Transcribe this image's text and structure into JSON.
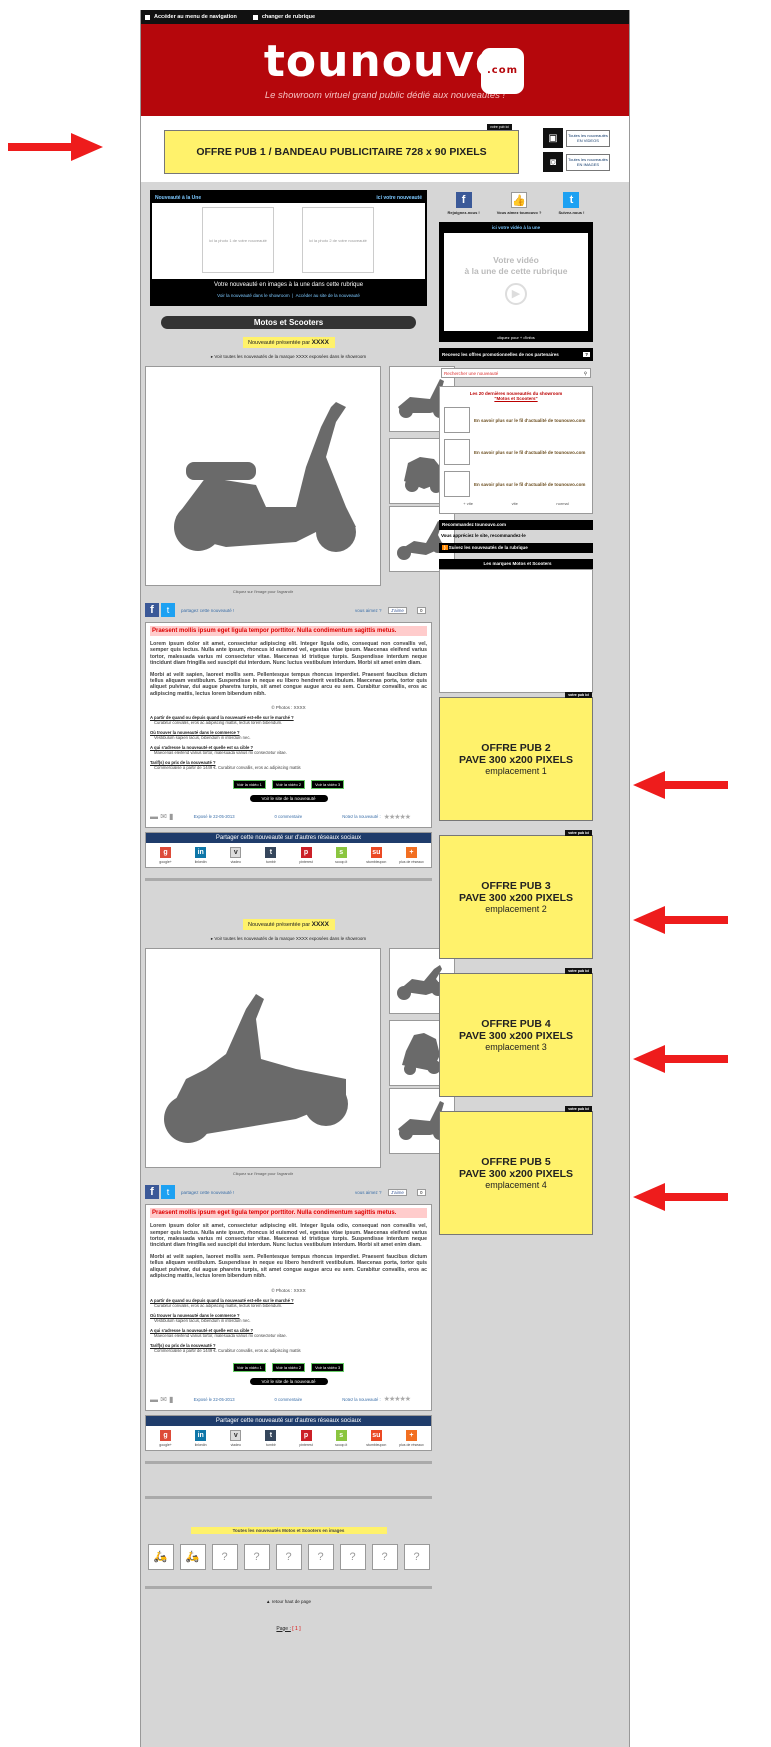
{
  "topbar": {
    "nav_link": "Accéder au menu de navigation",
    "change_link": "changer de rubrique"
  },
  "header": {
    "logo": "tounouvo",
    "logo_com": ".com",
    "tagline": "Le showroom virtuel grand public dédié aux nouveautés !"
  },
  "leaderboard": {
    "tag": "votre pub ici",
    "text": "OFFRE PUB 1 / BANDEAU PUBLICITAIRE 728 x 90 PIXELS",
    "videos_link": "Toutes les nouveautés EN VIDEOS",
    "images_link": "Toutes les nouveautés EN IMAGES"
  },
  "featured": {
    "title": "Nouveauté à la Une",
    "right_label": "ici votre nouveauté",
    "photo1": "ici la photo 1 de votre nouveauté",
    "photo2": "ici la photo 2 de votre nouveauté",
    "caption": "Votre nouveauté en images à la une dans cette rubrique",
    "link1": "Voir la nouveauté dans le showroom",
    "link2": "Accéder au site de la nouveauté"
  },
  "category_title": "Motos et Scooters",
  "products": [
    {
      "presented_by": "Nouveauté présentée par",
      "brand": "XXXX",
      "see_all": "Voir toutes les nouveautés de la marque XXXX exposées dans le showroom",
      "click_hint": "Cliquez sur l'image pour l'agrandir",
      "share_text": "partagez cette nouveauté !",
      "like_text": "vous aimez ?",
      "like_btn": "J'aime",
      "like_count": "0",
      "title": "Praesent mollis ipsum eget ligula tempor porttitor. Nulla condimentum sagittis metus.",
      "p1": "Lorem ipsum dolor sit amet, consectetur adipiscing elit. Integer ligula odio, consequat non convallis vel, semper quis lectus. Nulla ante ipsum, rhoncus id euismod vel, egestas vitae ipsum. Maecenas eleifend varius tortor, malesuada varius mi consectetur vitae. Maecenas id tristique turpis. Suspendisse interdum neque tincidunt diam fringilla sed suscipit dui interdum. Nunc luctus vestibulum interdum. Morbi sit amet enim diam.",
      "p2": "Morbi at velit sapien, laoreet mollis sem. Pellentesque tempus rhoncus imperdiet. Praesent faucibus dictum tellus aliquam vestibulum. Suspendisse in neque eu libero hendrerit vestibulum. Maecenas porta, tortor quis aliquet pulvinar, dui augue pharetra turpis, sit amet congue augue arcu eu sem. Curabitur convallis, eros ac adipiscing mattis, lectus lorem bibendum nibh.",
      "photo_credit": "© Photos : XXXX",
      "q1": "A partir de quand ou depuis quand la nouveauté est-elle sur le marché ?",
      "a1": "Curabitur convallis, eros ac adipiscing mattis, lectus lorem bibendum.",
      "q2": "Où trouver la nouveauté dans le commerce ?",
      "a2": "Vestibulum sapien lacus, bibendum in interdum nec.",
      "q3": "A qui s'adresse la nouveauté et quelle est sa cible ?",
      "a3": "Maecenas eleifend varius tortor, malesuada varius mi consectetur vitae.",
      "q4": "Tarif(s) ou prix de la nouveauté ?",
      "a4": "Commercialisé à partir de 1449 €. Curabitur convallis, eros ac adipiscing mattis",
      "v1": "Voir la vidéo 1",
      "v2": "Voir la vidéo 2",
      "v3": "Voir la vidéo 3",
      "site_btn": "Voir le site de la nouveauté",
      "exposed": "Exposé le 22-05-2013",
      "comments": "0 commentaire",
      "rate": "Notez la nouveauté :"
    },
    {
      "presented_by": "Nouveauté présentée par",
      "brand": "XXXX",
      "see_all": "Voir toutes les nouveautés de la marque XXXX exposées dans le showroom",
      "click_hint": "Cliquez sur l'image pour l'agrandir",
      "share_text": "partagez cette nouveauté !",
      "like_text": "vous aimez ?",
      "like_btn": "J'aime",
      "like_count": "0",
      "title": "Praesent mollis ipsum eget ligula tempor porttitor. Nulla condimentum sagittis metus.",
      "p1": "Lorem ipsum dolor sit amet, consectetur adipiscing elit. Integer ligula odio, consequat non convallis vel, semper quis lectus. Nulla ante ipsum, rhoncus id euismod vel, egestas vitae ipsum. Maecenas eleifend varius tortor, malesuada varius mi consectetur vitae. Maecenas id tristique turpis. Suspendisse interdum neque tincidunt diam fringilla sed suscipit dui interdum. Nunc luctus vestibulum interdum. Morbi sit amet enim diam.",
      "p2": "Morbi at velit sapien, laoreet mollis sem. Pellentesque tempus rhoncus imperdiet. Praesent faucibus dictum tellus aliquam vestibulum. Suspendisse in neque eu libero hendrerit vestibulum. Maecenas porta, tortor quis aliquet pulvinar, dui augue pharetra turpis, sit amet congue augue arcu eu sem. Curabitur convallis, eros ac adipiscing mattis, lectus lorem bibendum nibh.",
      "photo_credit": "© Photos : XXXX",
      "q1": "A partir de quand ou depuis quand la nouveauté est-elle sur le marché ?",
      "a1": "Curabitur convallis, eros ac adipiscing mattis, lectus lorem bibendum.",
      "q2": "Où trouver la nouveauté dans le commerce ?",
      "a2": "Vestibulum sapien lacus, bibendum in interdum nec.",
      "q3": "A qui s'adresse la nouveauté et quelle est sa cible ?",
      "a3": "Maecenas eleifend varius tortor, malesuada varius mi consectetur vitae.",
      "q4": "Tarif(s) ou prix de la nouveauté ?",
      "a4": "Commercialisé à partir de 1449 €. Curabitur convallis, eros ac adipiscing mattis",
      "v1": "Voir la vidéo 1",
      "v2": "Voir la vidéo 2",
      "v3": "Voir la vidéo 3",
      "site_btn": "Voir le site de la nouveauté",
      "exposed": "Exposé le 22-05-2013",
      "comments": "0 commentaire",
      "rate": "Notez la nouveauté :"
    }
  ],
  "share_networks": {
    "title": "Partager cette nouveauté sur d'autres réseaux sociaux",
    "items": [
      "google+",
      "linkedin",
      "viadeo",
      "tumblr",
      "pinterest",
      "scoop.it",
      "stumbleupon",
      "plus de réseaux"
    ]
  },
  "sidebar": {
    "social": {
      "join": "Rejoignez-nous !",
      "like": "Vous aimez tounouvo ?",
      "follow": "Suivez-nous !"
    },
    "video": {
      "header": "ici votre vidéo à la une",
      "line1": "Votre vidéo",
      "line2": "à la une de cette rubrique",
      "footer": "cliquez pour + d'infos"
    },
    "offers": "Recevez les offres promotionnelles de nos partenaires",
    "search_placeholder": "Rechercher une nouveauté",
    "last": {
      "title": "Les 20 dernières nouveautés du showroom",
      "subtitle": "\"Motos et Scooters\"",
      "item_text": "En savoir plus sur le fil d'actualité de tounouvo.com",
      "tabs": [
        "+ vite",
        "vite",
        "normal"
      ]
    },
    "recommend": "Recommandez tounouvo.com",
    "recommend_sub": "Vous appréciez le site, recommandez-le",
    "follow_rubrique": "Suivez les nouveautés de la rubrique",
    "brands": "Les marques Motos et Scooters",
    "ad_tag": "votre pub ici",
    "ads": [
      {
        "l1": "OFFRE PUB 2",
        "l2": "PAVE 300 x200 PIXELS",
        "l3": "emplacement 1"
      },
      {
        "l1": "OFFRE PUB 3",
        "l2": "PAVE 300 x200 PIXELS",
        "l3": "emplacement 2"
      },
      {
        "l1": "OFFRE PUB 4",
        "l2": "PAVE 300 x200 PIXELS",
        "l3": "emplacement 3"
      },
      {
        "l1": "OFFRE PUB 5",
        "l2": "PAVE 300 x200 PIXELS",
        "l3": "emplacement 4"
      }
    ]
  },
  "footer": {
    "all_images": "Toutes les nouveautés Motos et Scooters en images",
    "back_top": "retour haut de page",
    "page_label": "Page :",
    "page_num": "[ 1 ]"
  },
  "colors": {
    "brand_red": "#b5070c",
    "ad_yellow": "#fff26b",
    "arrow_red": "#ee1c1c"
  }
}
